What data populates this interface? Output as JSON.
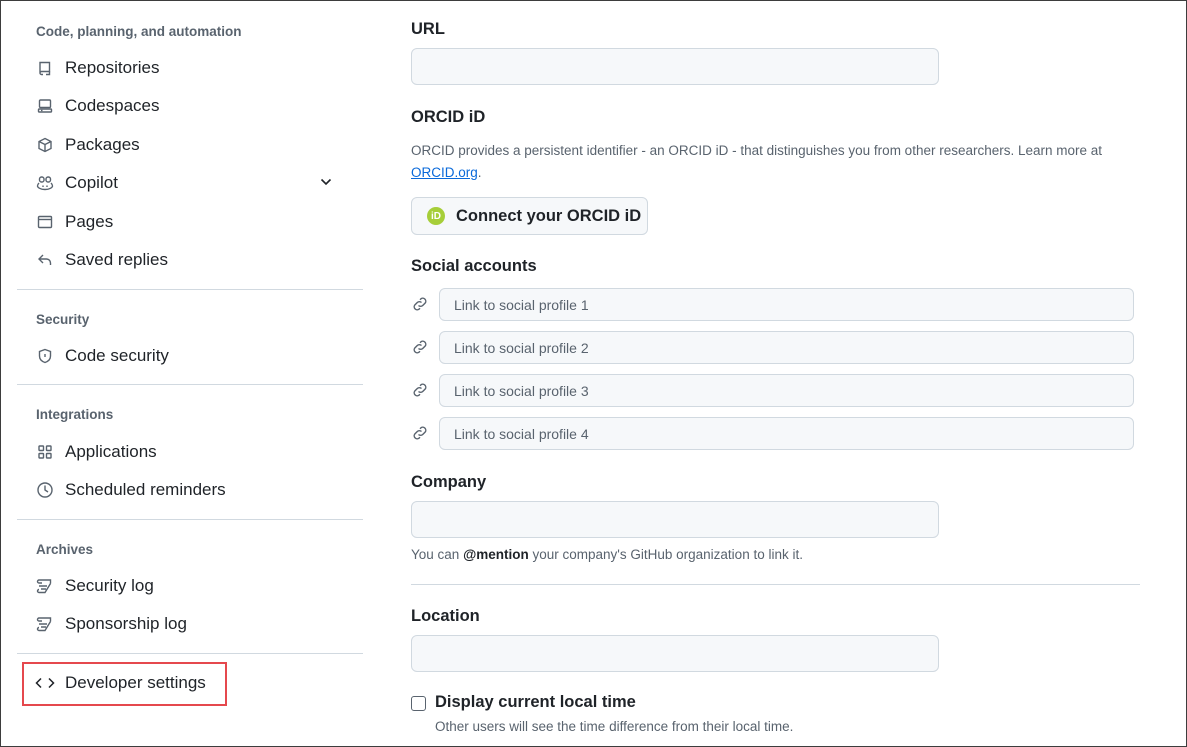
{
  "sidebar": {
    "sections": [
      {
        "title": "Code, planning, and automation",
        "items": [
          {
            "label": "Repositories",
            "icon": "repo-icon"
          },
          {
            "label": "Codespaces",
            "icon": "codespaces-icon"
          },
          {
            "label": "Packages",
            "icon": "package-icon"
          },
          {
            "label": "Copilot",
            "icon": "copilot-icon"
          },
          {
            "label": "Pages",
            "icon": "browser-icon"
          },
          {
            "label": "Saved replies",
            "icon": "reply-icon"
          }
        ]
      },
      {
        "title": "Security",
        "items": [
          {
            "label": "Code security",
            "icon": "shield-icon"
          }
        ]
      },
      {
        "title": "Integrations",
        "items": [
          {
            "label": "Applications",
            "icon": "apps-icon"
          },
          {
            "label": "Scheduled reminders",
            "icon": "clock-icon"
          }
        ]
      },
      {
        "title": "Archives",
        "items": [
          {
            "label": "Security log",
            "icon": "log-icon"
          },
          {
            "label": "Sponsorship log",
            "icon": "log-icon"
          }
        ]
      }
    ],
    "developer_settings": {
      "label": "Developer settings",
      "icon": "code-icon"
    }
  },
  "main": {
    "url": {
      "label": "URL",
      "value": ""
    },
    "orcid": {
      "label": "ORCID iD",
      "description": "ORCID provides a persistent identifier - an ORCID iD - that distinguishes you from other researchers. Learn more at",
      "link_text": "ORCID.org",
      "button_label": "Connect your ORCID iD",
      "badge": "iD"
    },
    "social": {
      "label": "Social accounts",
      "placeholders": [
        "Link to social profile 1",
        "Link to social profile 2",
        "Link to social profile 3",
        "Link to social profile 4"
      ]
    },
    "company": {
      "label": "Company",
      "value": "",
      "help_prefix": "You can",
      "help_mention": "@mention",
      "help_suffix": "your company's GitHub organization to link it."
    },
    "location": {
      "label": "Location",
      "value": ""
    },
    "local_time": {
      "label": "Display current local time",
      "checked": false,
      "description": "Other users will see the time difference from their local time."
    }
  },
  "colors": {
    "highlight": "#e5484d",
    "link": "#0969da",
    "orcid_green": "#a6ce39"
  }
}
